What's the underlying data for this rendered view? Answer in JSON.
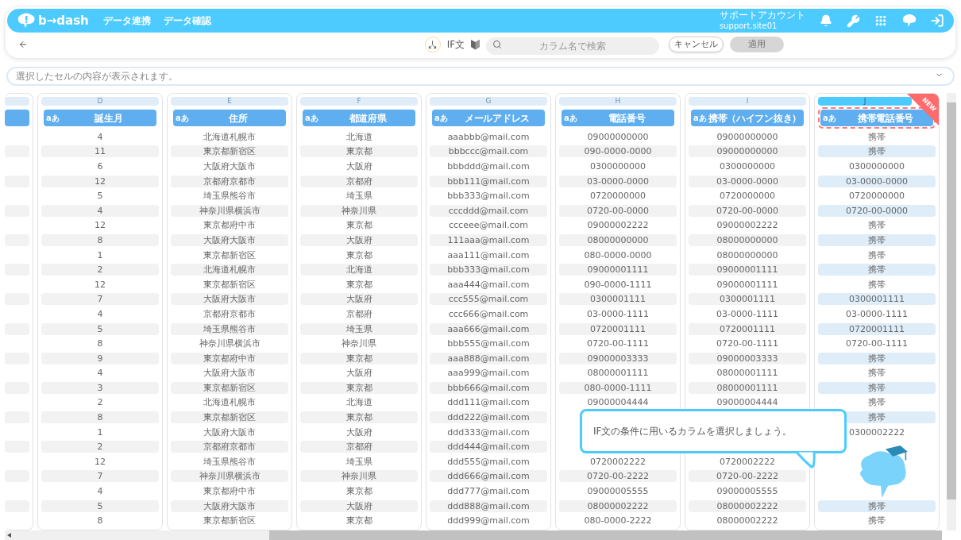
{
  "nav": {
    "logo": "b→dash",
    "links": [
      "データ連携",
      "データ確認"
    ],
    "account_label": "サポートアカウント",
    "account_id": "support.site01"
  },
  "toolbar": {
    "mode_label": "IF文",
    "search": {
      "placeholder": "カラム名で検索"
    },
    "cancel": "キャンセル",
    "apply": {
      "label": "適用",
      "disabled": true
    }
  },
  "cell_viewer": {
    "placeholder": "選択したセルの内容が表示されます。"
  },
  "columns": [
    {
      "letter": "D",
      "type_label": "aあ",
      "title": "誕生月",
      "new": false,
      "selected": false,
      "cells": [
        "4",
        "11",
        "6",
        "12",
        "5",
        "4",
        "12",
        "8",
        "1",
        "2",
        "12",
        "7",
        "4",
        "5",
        "8",
        "9",
        "4",
        "3",
        "2",
        "8",
        "1",
        "2",
        "12",
        "7",
        "4",
        "5",
        "8"
      ]
    },
    {
      "letter": "E",
      "type_label": "aあ",
      "title": "住所",
      "new": false,
      "selected": false,
      "cells": [
        "北海道札幌市",
        "東京都新宿区",
        "大阪府大阪市",
        "京都府京都市",
        "埼玉県熊谷市",
        "神奈川県横浜市",
        "東京都府中市",
        "大阪府大阪市",
        "東京都新宿区",
        "北海道札幌市",
        "東京都新宿区",
        "大阪府大阪市",
        "京都府京都市",
        "埼玉県熊谷市",
        "神奈川県横浜市",
        "東京都府中市",
        "大阪府大阪市",
        "東京都新宿区",
        "北海道札幌市",
        "東京都新宿区",
        "大阪府大阪市",
        "京都府京都市",
        "埼玉県熊谷市",
        "神奈川県横浜市",
        "東京都府中市",
        "大阪府大阪市",
        "東京都新宿区"
      ]
    },
    {
      "letter": "F",
      "type_label": "aあ",
      "title": "都道府県",
      "new": false,
      "selected": false,
      "cells": [
        "北海道",
        "東京都",
        "大阪府",
        "京都府",
        "埼玉県",
        "神奈川県",
        "東京都",
        "大阪府",
        "東京都",
        "北海道",
        "東京都",
        "大阪府",
        "京都府",
        "埼玉県",
        "神奈川県",
        "東京都",
        "大阪府",
        "東京都",
        "北海道",
        "東京都",
        "大阪府",
        "京都府",
        "埼玉県",
        "神奈川県",
        "東京都",
        "大阪府",
        "東京都"
      ]
    },
    {
      "letter": "G",
      "type_label": "aあ",
      "title": "メールアドレス",
      "new": false,
      "selected": false,
      "cells": [
        "aaabbb@mail.com",
        "bbbccc@mail.com",
        "bbbddd@mail.com",
        "bbb111@mail.com",
        "bbb333@mail.com",
        "cccddd@mail.com",
        "ccceee@mail.com",
        "111aaa@mail.com",
        "aaa111@mail.com",
        "bbb333@mail.com",
        "aaa444@mail.com",
        "ccc555@mail.com",
        "ccc666@mail.com",
        "aaa666@mail.com",
        "bbb555@mail.com",
        "aaa888@mail.com",
        "aaa999@mail.com",
        "bbb666@mail.com",
        "ddd111@mail.com",
        "ddd222@mail.com",
        "ddd333@mail.com",
        "ddd444@mail.com",
        "ddd555@mail.com",
        "ddd666@mail.com",
        "ddd777@mail.com",
        "ddd888@mail.com",
        "ddd999@mail.com"
      ]
    },
    {
      "letter": "H",
      "type_label": "aあ",
      "title": "電話番号",
      "new": false,
      "selected": false,
      "cells": [
        "09000000000",
        "090-0000-0000",
        "0300000000",
        "03-0000-0000",
        "0720000000",
        "0720-00-0000",
        "09000002222",
        "08000000000",
        "080-0000-0000",
        "09000001111",
        "090-0000-1111",
        "0300001111",
        "03-0000-1111",
        "0720001111",
        "0720-00-1111",
        "09000003333",
        "08000001111",
        "080-0000-1111",
        "09000004444",
        null,
        null,
        null,
        "0720002222",
        "0720-00-2222",
        "09000005555",
        "08000002222",
        "080-0000-2222"
      ]
    },
    {
      "letter": "I",
      "type_label": "aあ",
      "title": "携帯（ハイフン抜き）",
      "new": false,
      "selected": false,
      "cells": [
        "09000000000",
        "09000000000",
        "0300000000",
        "03-0000-0000",
        "0720000000",
        "0720-00-0000",
        "09000002222",
        "08000000000",
        "08000000000",
        "09000001111",
        "09000001111",
        "0300001111",
        "03-0000-1111",
        "0720001111",
        "0720-00-1111",
        "09000003333",
        "08000001111",
        "08000001111",
        "09000004444",
        null,
        null,
        null,
        "0720002222",
        "0720-00-2222",
        "09000005555",
        "08000002222",
        "08000002222"
      ]
    },
    {
      "letter": "J",
      "type_label": "aあ",
      "title": "携帯電話番号",
      "new": true,
      "selected": true,
      "cells": [
        "携帯",
        "携帯",
        "0300000000",
        "03-0000-0000",
        "0720000000",
        "0720-00-0000",
        "携帯",
        "携帯",
        "携帯",
        "携帯",
        "携帯",
        "0300001111",
        "03-0000-1111",
        "0720001111",
        "0720-00-1111",
        "携帯",
        "携帯",
        "携帯",
        "携帯",
        "携帯",
        "0300002222",
        null,
        null,
        null,
        null,
        "携帯",
        "携帯"
      ]
    }
  ],
  "new_badge": "NEW",
  "tip": {
    "text": "IF文の条件に用いるカラムを選択しましょう。"
  }
}
